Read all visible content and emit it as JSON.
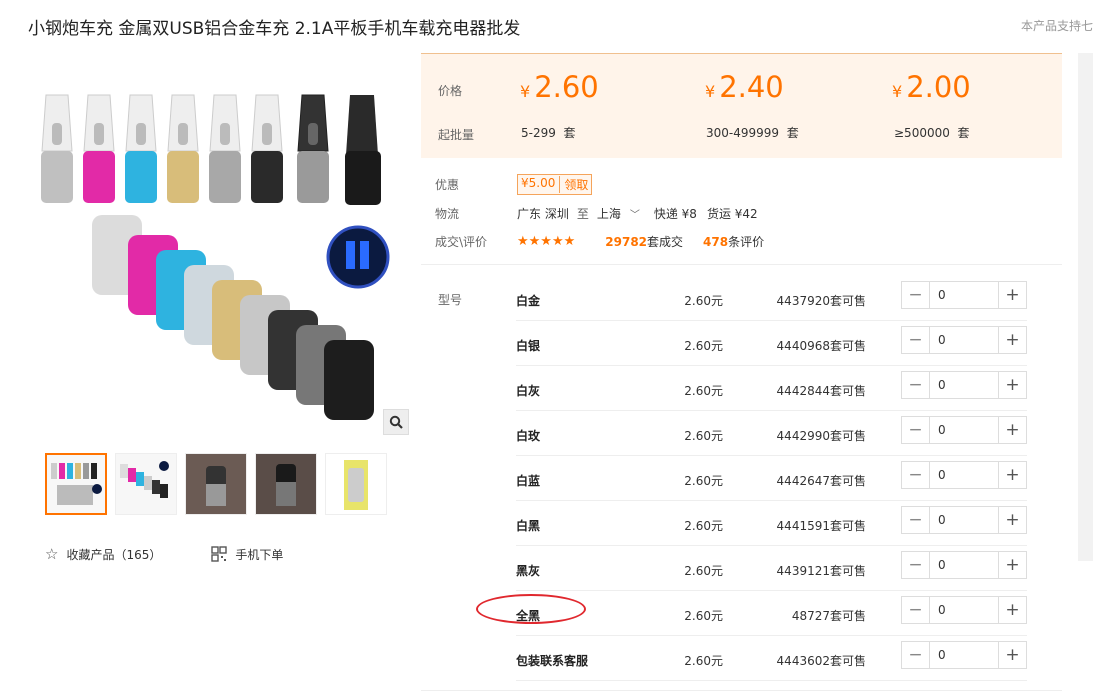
{
  "product": {
    "title": "小钢炮车充 金属双USB铝合金车充 2.1A平板手机车载充电器批发",
    "support_text": "本产品支持七"
  },
  "gallery": {
    "thumb_count": 5,
    "favorite_label": "收藏产品（165）",
    "mobile_order_label": "手机下单"
  },
  "price_box": {
    "price_label": "价格",
    "moq_label": "起批量",
    "currency": "¥",
    "tiers": [
      {
        "price": "2.60",
        "range": "5-299",
        "unit": "套"
      },
      {
        "price": "2.40",
        "range": "300-499999",
        "unit": "套"
      },
      {
        "price": "2.00",
        "range": "≥500000",
        "unit": "套"
      }
    ]
  },
  "promo": {
    "label": "优惠",
    "coupon_value": "¥5.00",
    "coupon_action": "领取"
  },
  "logistics": {
    "label": "物流",
    "from": "广东 深圳",
    "to_word": "至",
    "to": "上海",
    "express": "快递 ¥8",
    "freight": "货运 ¥42"
  },
  "deals": {
    "label": "成交\\评价",
    "stars": "★★★★★",
    "deal_count": "29782",
    "deal_suffix": "套成交",
    "review_count": "478",
    "review_suffix": "条评价"
  },
  "sku": {
    "label": "型号",
    "rows": [
      {
        "name": "白金",
        "price": "2.60元",
        "stock": "4437920套可售",
        "qty": "0"
      },
      {
        "name": "白银",
        "price": "2.60元",
        "stock": "4440968套可售",
        "qty": "0"
      },
      {
        "name": "白灰",
        "price": "2.60元",
        "stock": "4442844套可售",
        "qty": "0"
      },
      {
        "name": "白玫",
        "price": "2.60元",
        "stock": "4442990套可售",
        "qty": "0"
      },
      {
        "name": "白蓝",
        "price": "2.60元",
        "stock": "4442647套可售",
        "qty": "0"
      },
      {
        "name": "白黑",
        "price": "2.60元",
        "stock": "4441591套可售",
        "qty": "0"
      },
      {
        "name": "黑灰",
        "price": "2.60元",
        "stock": "4439121套可售",
        "qty": "0"
      },
      {
        "name": "全黑",
        "price": "2.60元",
        "stock": "48727套可售",
        "qty": "0"
      },
      {
        "name": "包装联系客服",
        "price": "2.60元",
        "stock": "4443602套可售",
        "qty": "0"
      }
    ]
  },
  "colors": {
    "accent": "#ff7300",
    "price_bg": "#fff4ea",
    "annotation": "#e0282e"
  }
}
